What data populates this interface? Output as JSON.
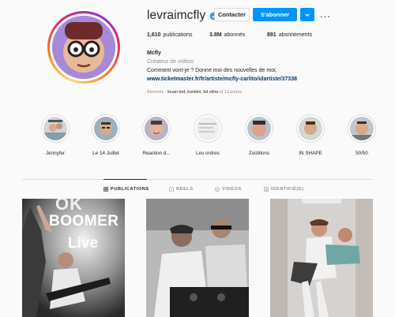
{
  "profile": {
    "username": "levraimcfly",
    "full_name": "Mcfly",
    "category": "Créateur de vidéos",
    "bio": "Comment vont-je ? Donne moi des nouvelles de moi.",
    "link": "www.ticketmaster.fr/fr/artiste/mcfly-carlito/idartiste/37338",
    "followed_by_prefix": "Abonnés : ",
    "followed_by_names": "louan.brd, konbini, bd.vkha",
    "followed_by_suffix": " et 13 autres"
  },
  "actions": {
    "contact_label": "Contacter",
    "follow_label": "S'abonner",
    "more_label": "..."
  },
  "stats": {
    "posts_count": "1,610",
    "posts_label": "publications",
    "followers_count": "3.8M",
    "followers_label": "abonnés",
    "following_count": "891",
    "following_label": "abonnements"
  },
  "highlights": [
    {
      "label": "Jennyfer"
    },
    {
      "label": "Le 14 Juillet"
    },
    {
      "label": "Reaction d..."
    },
    {
      "label": "Les ordres"
    },
    {
      "label": "Zoizillons"
    },
    {
      "label": "IN SHAPE"
    },
    {
      "label": "50/50"
    }
  ],
  "tabs": [
    {
      "label": "PUBLICATIONS",
      "icon": "grid-icon",
      "active": true
    },
    {
      "label": "REELS",
      "icon": "reels-icon",
      "active": false
    },
    {
      "label": "VIDÉOS",
      "icon": "video-icon",
      "active": false
    },
    {
      "label": "IDENTIFIÉ(E)",
      "icon": "tagged-icon",
      "active": false
    }
  ],
  "posts": [
    {
      "overlay_line1": "OK",
      "overlay_line2": "BOOMER",
      "overlay_line3": "Live"
    },
    {},
    {}
  ],
  "colors": {
    "accent": "#0095f6",
    "link": "#00376b",
    "muted": "#8e8e8e",
    "verified": "#3897f0"
  }
}
